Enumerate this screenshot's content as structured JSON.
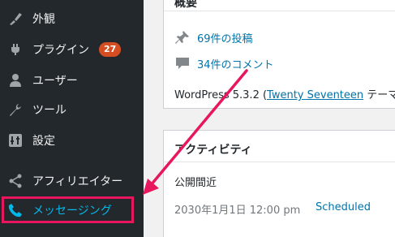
{
  "sidebar": {
    "items": [
      {
        "label": "外観",
        "icon": "paintbrush-icon"
      },
      {
        "label": "プラグイン",
        "icon": "plugin-icon",
        "badge": "27"
      },
      {
        "label": "ユーザー",
        "icon": "user-icon"
      },
      {
        "label": "ツール",
        "icon": "wrench-icon"
      },
      {
        "label": "設定",
        "icon": "settings-icon"
      },
      {
        "label": "アフィリエイター",
        "icon": "share-icon"
      },
      {
        "label": "メッセージング",
        "icon": "phone-icon"
      }
    ],
    "highlight_color": "#e8175d",
    "active_text_color": "#00b9eb"
  },
  "at_a_glance": {
    "title": "概要",
    "posts": "69件の投稿",
    "comments": "34件のコメント",
    "wp_version_prefix": "WordPress 5.3.2 (",
    "theme_name": "Twenty Seventeen",
    "theme_suffix": " テーマ"
  },
  "activity": {
    "title": "アクティビティ",
    "subheading": "公開間近",
    "row_date": "2030年1月1日 12:00 pm",
    "row_status": "Scheduled"
  },
  "annotation": {
    "color": "#e8175d"
  }
}
